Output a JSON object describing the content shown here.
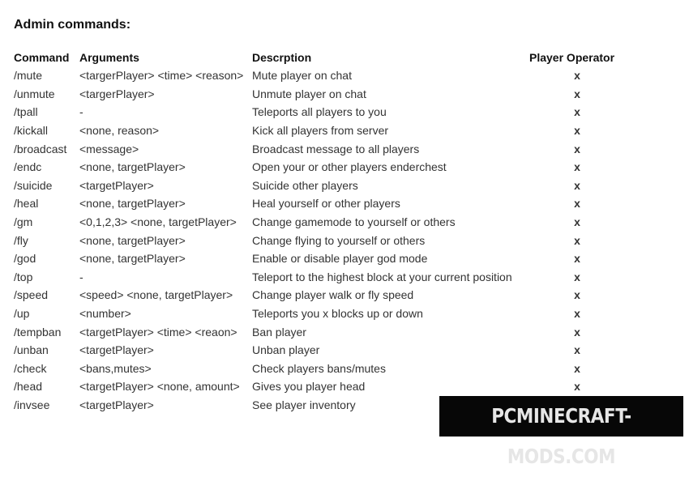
{
  "heading": "Admin commands:",
  "table": {
    "headers": {
      "command": "Command",
      "arguments": "Arguments",
      "description": "Descrption",
      "operator": "Player Operator"
    },
    "rows": [
      {
        "command": "/mute",
        "arguments": "<targerPlayer> <time> <reason>",
        "description": "Mute player on chat",
        "operator": "x"
      },
      {
        "command": "/unmute",
        "arguments": "<targerPlayer>",
        "description": "Unmute player on chat",
        "operator": "x"
      },
      {
        "command": "/tpall",
        "arguments": "-",
        "description": "Teleports all players to you",
        "operator": "x"
      },
      {
        "command": "/kickall",
        "arguments": "<none, reason>",
        "description": "Kick all players from server",
        "operator": "x"
      },
      {
        "command": "/broadcast",
        "arguments": "<message>",
        "description": "Broadcast message to all players",
        "operator": "x"
      },
      {
        "command": "/endc",
        "arguments": "<none, targetPlayer>",
        "description": "Open your or other players enderchest",
        "operator": "x"
      },
      {
        "command": "/suicide",
        "arguments": "<targetPlayer>",
        "description": "Suicide other players",
        "operator": "x"
      },
      {
        "command": "/heal",
        "arguments": "<none, targetPlayer>",
        "description": " Heal yourself or other players",
        "operator": "x"
      },
      {
        "command": "/gm",
        "arguments": "<0,1,2,3> <none, targetPlayer>",
        "description": "Change gamemode to yourself or others",
        "operator": "x"
      },
      {
        "command": "/fly",
        "arguments": "<none, targetPlayer>",
        "description": "Change flying to yourself or others",
        "operator": "x"
      },
      {
        "command": "/god",
        "arguments": "<none, targetPlayer>",
        "description": "Enable or disable player god mode",
        "operator": "x"
      },
      {
        "command": "/top",
        "arguments": "-",
        "description": "Teleport to the highest block at your current position",
        "operator": "x"
      },
      {
        "command": "/speed",
        "arguments": "<speed> <none, targetPlayer>",
        "description": "Change player walk or fly speed",
        "operator": "x"
      },
      {
        "command": "/up",
        "arguments": "<number>",
        "description": "Teleports you x blocks up or down",
        "operator": "x"
      },
      {
        "command": "/tempban",
        "arguments": "<targetPlayer> <time> <reaon>",
        "description": "Ban player",
        "operator": "x"
      },
      {
        "command": "/unban",
        "arguments": "<targetPlayer>",
        "description": "Unban player",
        "operator": "x"
      },
      {
        "command": "/check",
        "arguments": "<bans,mutes>",
        "description": "Check players bans/mutes",
        "operator": "x"
      },
      {
        "command": "/head",
        "arguments": "<targetPlayer> <none, amount>",
        "description": "Gives you player head",
        "operator": "x"
      },
      {
        "command": "/invsee",
        "arguments": "<targetPlayer>",
        "description": "See player inventory",
        "operator": ""
      }
    ]
  },
  "watermark": "PCMINECRAFT-MODS.COM"
}
